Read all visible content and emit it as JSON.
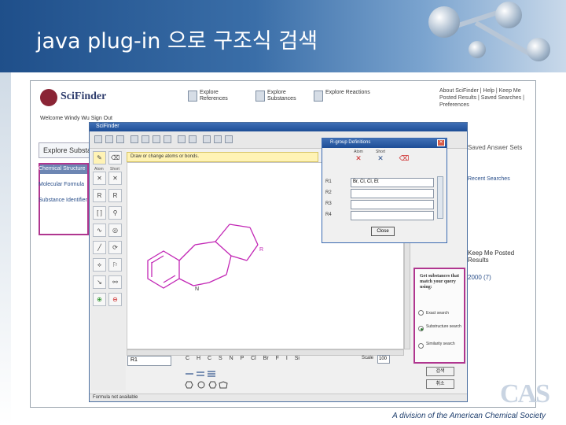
{
  "slide": {
    "title": "java plug-in 으로 구조식 검색",
    "footer": "A division of the American Chemical Society"
  },
  "app": {
    "brand": "SciFinder",
    "nav": [
      {
        "label": "Explore References",
        "icon": "document-icon"
      },
      {
        "label": "Explore Substances",
        "icon": "molecule-icon"
      },
      {
        "label": "Explore Reactions",
        "icon": "reaction-icon"
      }
    ],
    "top_links": "About SciFinder | Help | Keep Me Posted Results | Saved Searches | Preferences",
    "welcome": "Welcome Windy Wu   Sign Out",
    "explore_tab": "Explore Substances",
    "left_menu": [
      "Chemical Structure",
      "Molecular Formula",
      "Substance Identifier"
    ],
    "right_texts": {
      "t1": "Saved Answer Sets",
      "t2": "Recent Searches",
      "t3": "Keep Me Posted Results",
      "t4": "2000 (7)"
    }
  },
  "editor": {
    "title": "SciFinder",
    "hint": "Draw or change atoms or bonds.",
    "label_input": "R1",
    "elements": "C H C S N P Cl Br F I Si",
    "scale_label": "Scale",
    "scale_value": "100",
    "status": "Formula not available",
    "palette": [
      "Atom",
      "Short"
    ]
  },
  "query": {
    "text": "Get substances that match your query using:",
    "options": [
      "Exact search",
      "Substructure search",
      "Similarity search"
    ],
    "selected": 1,
    "ok_label": "검색",
    "cancel_label": "취소"
  },
  "rgroup": {
    "title": "R-group Definitions",
    "tools": [
      "Atom",
      "Short"
    ],
    "rows": [
      {
        "label": "R1",
        "value": "Br, Cl, Cl, Et"
      },
      {
        "label": "R2",
        "value": ""
      },
      {
        "label": "R3",
        "value": ""
      },
      {
        "label": "R4",
        "value": ""
      }
    ],
    "close_label": "Close"
  },
  "colors": {
    "structure": "#c226b5",
    "highlight_border": "#b0368f",
    "header_dark": "#1f4f8a"
  }
}
